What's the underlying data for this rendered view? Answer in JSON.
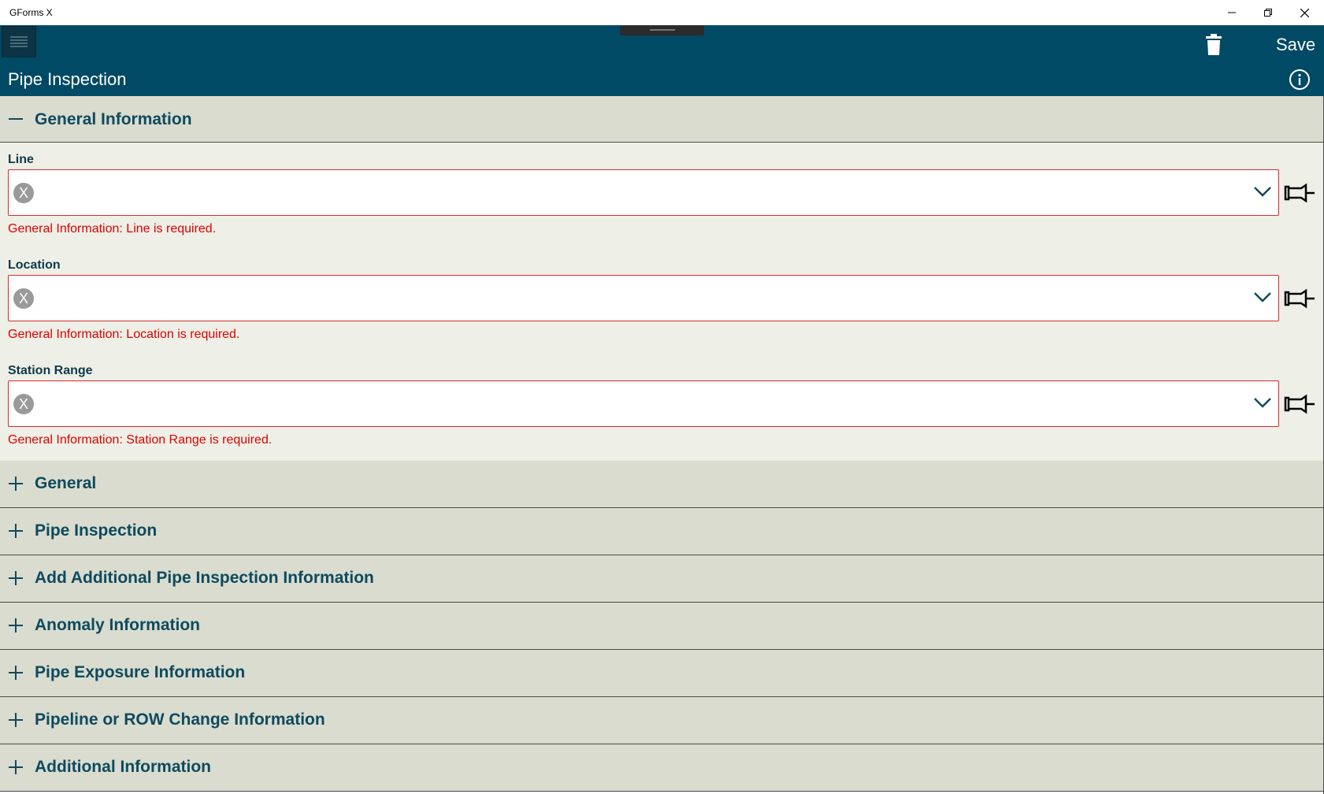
{
  "window": {
    "title": "GForms X"
  },
  "header": {
    "save_label": "Save",
    "form_title": "Pipe Inspection"
  },
  "colors": {
    "header_bg": "#004a66",
    "section_bg": "#d9dccf",
    "body_bg": "#eeefe6",
    "error": "#e00000",
    "heading_text": "#0e4a5e"
  },
  "sections": {
    "open": {
      "title": "General Information",
      "fields": [
        {
          "label": "Line",
          "value": "",
          "clear_glyph": "X",
          "error": "General Information: Line is required."
        },
        {
          "label": "Location",
          "value": "",
          "clear_glyph": "X",
          "error": "General Information: Location is required."
        },
        {
          "label": "Station Range",
          "value": "",
          "clear_glyph": "X",
          "error": "General Information: Station Range is required."
        }
      ]
    },
    "collapsed": [
      {
        "title": "General"
      },
      {
        "title": "Pipe Inspection"
      },
      {
        "title": "Add Additional Pipe Inspection Information"
      },
      {
        "title": "Anomaly Information"
      },
      {
        "title": "Pipe Exposure Information"
      },
      {
        "title": "Pipeline or ROW Change Information"
      },
      {
        "title": "Additional Information"
      }
    ]
  },
  "icons": [
    "hamburger-icon",
    "minimize-icon",
    "restore-icon",
    "close-icon",
    "trash-icon",
    "info-icon",
    "minus-icon",
    "plus-icon",
    "chevron-down-icon",
    "pin-icon",
    "clear-icon"
  ]
}
